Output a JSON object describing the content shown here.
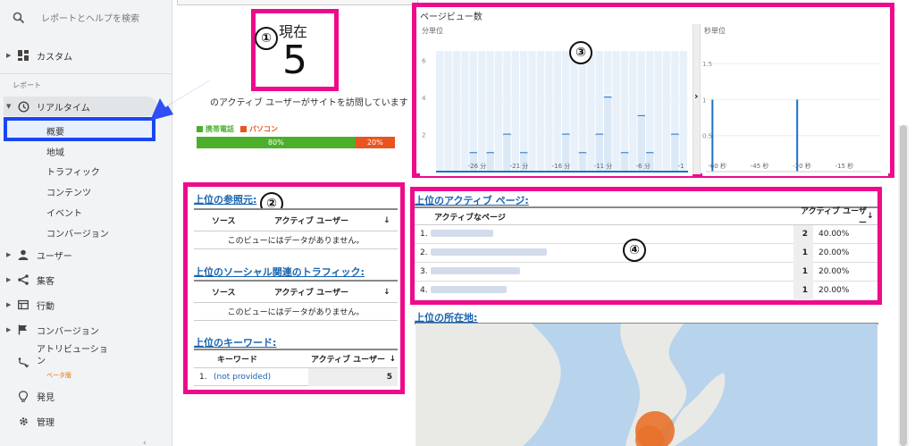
{
  "sidebar": {
    "search_placeholder": "レポートとヘルプを検索",
    "custom": "カスタム",
    "reports_label": "レポート",
    "realtime": "リアルタイム",
    "realtime_items": [
      "概要",
      "地域",
      "トラフィック",
      "コンテンツ",
      "イベント",
      "コンバージョン"
    ],
    "users": "ユーザー",
    "acquisition": "集客",
    "behavior": "行動",
    "conversions": "コンバージョン",
    "attribution_line1": "アトリビューショ",
    "attribution_line2": "ン",
    "beta": "ベータ版",
    "discover": "発見",
    "admin": "管理",
    "collapse": "‹"
  },
  "now": {
    "label": "現在",
    "value": "5"
  },
  "badges": [
    "①",
    "②",
    "③",
    "④"
  ],
  "active_text": "のアクティブ ユーザーがサイトを訪問しています",
  "device": {
    "mobile_label": "携帯電話",
    "desktop_label": "パソコン",
    "mobile_pct": 80,
    "desktop_pct": 20,
    "mobile_text": "80%",
    "desktop_text": "20%",
    "mobile_color": "#4caf2b",
    "desktop_color": "#e8551f"
  },
  "referrers": {
    "title": "上位の参照元:",
    "col1": "ソース",
    "col2": "アクティブ ユーザー",
    "sort": "↓",
    "empty": "このビューにはデータがありません。"
  },
  "social": {
    "title": "上位のソーシャル関連のトラフィック:",
    "col1": "ソース",
    "col2": "アクティブ ユーザー",
    "sort": "↓",
    "empty": "このビューにはデータがありません。"
  },
  "keywords": {
    "title": "上位のキーワード:",
    "col1": "キーワード",
    "col2": "アクティブ ユーザー",
    "sort": "↓",
    "rows": [
      {
        "n": "1.",
        "kw": "(not provided)",
        "users": "5"
      }
    ]
  },
  "pageviews": {
    "title": "ページビュー数",
    "minute_label": "分単位",
    "second_label": "秒単位",
    "minute_yticks": [
      "6",
      "4",
      "2"
    ],
    "second_yticks": [
      "1.5",
      "1",
      "0.5"
    ],
    "minute_xticks": [
      "-26 分",
      "-21 分",
      "-16 分",
      "-11 分",
      "-6 分",
      "-1"
    ],
    "second_xticks": [
      "-60 秒",
      "-45 秒",
      "-30 秒",
      "-15 秒"
    ],
    "expand_arrow": "›"
  },
  "chart_data": [
    {
      "type": "bar",
      "title": "分単位",
      "x": [
        -30,
        -29,
        -28,
        -27,
        -26,
        -25,
        -24,
        -23,
        -22,
        -21,
        -20,
        -19,
        -18,
        -17,
        -16,
        -15,
        -14,
        -13,
        -12,
        -11,
        -10,
        -9,
        -8,
        -7,
        -6,
        -5,
        -4,
        -3,
        -2,
        -1
      ],
      "values": [
        0,
        0,
        0,
        0,
        1,
        0,
        1,
        0,
        2,
        0,
        1,
        0,
        0,
        0,
        0,
        2,
        0,
        1,
        0,
        2,
        4,
        0,
        1,
        0,
        3,
        1,
        0,
        0,
        2,
        0
      ],
      "xticks": [
        "-26 分",
        "-21 分",
        "-16 分",
        "-11 分",
        "-6 分",
        "-1"
      ],
      "ylim": [
        0,
        7
      ]
    },
    {
      "type": "bar",
      "title": "秒単位",
      "x": [
        -60,
        -30
      ],
      "values": [
        1,
        1
      ],
      "xticks": [
        "-60 秒",
        "-45 秒",
        "-30 秒",
        "-15 秒"
      ],
      "ylim": [
        0,
        1.8
      ]
    }
  ],
  "active_pages": {
    "title": "上位のアクティブ ページ:",
    "col1": "アクティブなページ",
    "col2": "アクティブ ユーザー",
    "sort": "↓",
    "rows": [
      {
        "n": "1.",
        "users": "2",
        "pct": "40.00%",
        "bar": 0.4
      },
      {
        "n": "2.",
        "users": "1",
        "pct": "20.00%",
        "bar": 0.2
      },
      {
        "n": "3.",
        "users": "1",
        "pct": "20.00%",
        "bar": 0.2
      },
      {
        "n": "4.",
        "users": "1",
        "pct": "20.00%",
        "bar": 0.2
      }
    ]
  },
  "locations": {
    "title": "上位の所在地:"
  },
  "colors": {
    "accent": "#ef0a8c",
    "arrow": "#2f4ef5",
    "link": "#1a64b0",
    "bar": "#1a73c8"
  }
}
